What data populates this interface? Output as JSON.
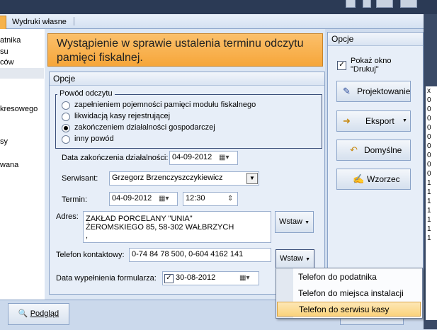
{
  "tabs": {
    "second": "Wydruki własne"
  },
  "left_list": [
    "atnika",
    "su",
    "ców",
    "kresowego",
    "sy",
    "wana"
  ],
  "right_list": [
    "x",
    "0",
    "0",
    "0",
    "0",
    "0",
    "0",
    "0",
    "0",
    "0",
    "1",
    "1",
    "1",
    "1",
    "1",
    "1",
    "1"
  ],
  "header": {
    "title": "Wystąpienie w sprawie ustalenia terminu odczytu pamięci fiskalnej."
  },
  "opcje_group": {
    "title": "Opcje",
    "reason_legend": "Powód odczytu",
    "reasons": [
      "zapełnieniem pojemności pamięci modułu fiskalnego",
      "likwidacją kasy rejestrującej",
      "zakończeniem działalności gospodarczej",
      "inny powód"
    ],
    "selected_reason": 2,
    "end_date_label": "Data zakończenia działalności:",
    "end_date": "04-09-2012",
    "serwisant_label": "Serwisant:",
    "serwisant": "Grzegorz Brzenczyszczykiewicz",
    "termin_label": "Termin:",
    "termin_date": "04-09-2012",
    "termin_time": "12:30",
    "adres_label": "Adres:",
    "adres_line1": "ZAKŁAD PORCELANY \"UNIA\"",
    "adres_line2": "ŻEROMSKIEGO 85, 58-302 WAŁBRZYCH",
    "adres_line3": ",",
    "wstaw": "Wstaw",
    "telefon_label": "Telefon kontaktowy:",
    "telefon": "0-74 84 78 500, 0-604 4162 141",
    "fill_date_label": "Data wypełnienia formularza:",
    "fill_date": "30-08-2012"
  },
  "right_panel": {
    "title": "Opcje",
    "show_window": "Pokaż okno \"Drukuj\"",
    "buttons": [
      "Projektowanie",
      "Eksport",
      "Domyślne",
      "Wzorzec"
    ]
  },
  "bottom": {
    "preview": "Podgląd"
  },
  "dropdown": [
    "Telefon do podatnika",
    "Telefon do miejsca instalacji",
    "Telefon do serwisu kasy"
  ],
  "colors": {
    "header_orange": "#f6a63a",
    "highlight": "#fbd37c",
    "panel": "#e7eef8"
  }
}
